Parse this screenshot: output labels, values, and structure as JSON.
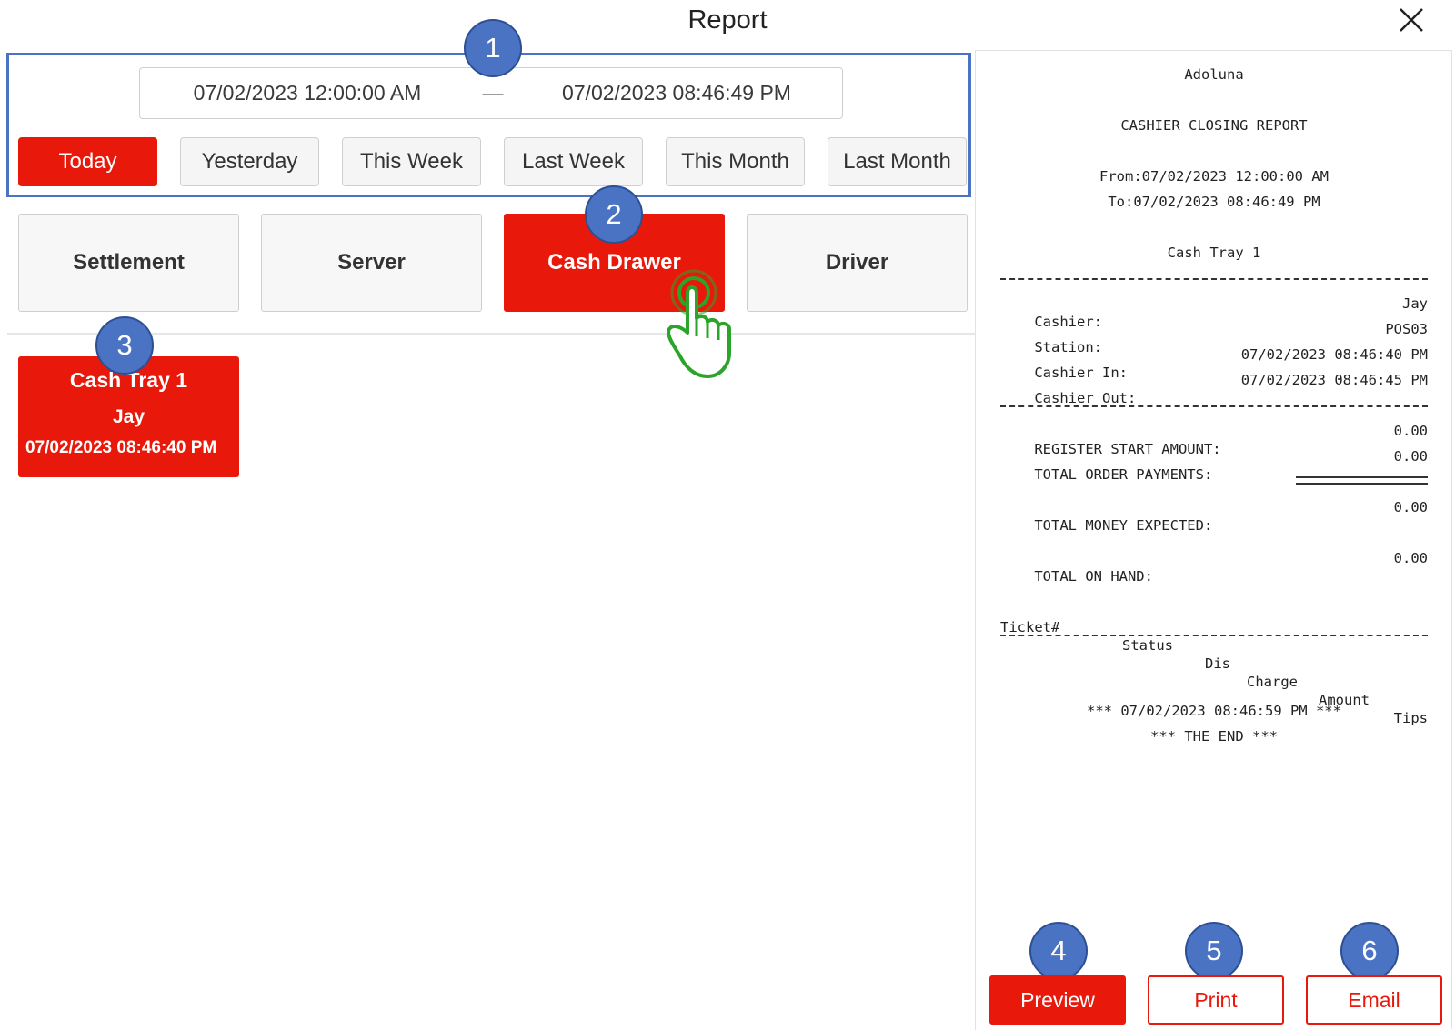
{
  "header": {
    "title": "Report"
  },
  "date_range": {
    "from": "07/02/2023 12:00:00 AM",
    "separator": "—",
    "to": "07/02/2023 08:46:49 PM"
  },
  "presets": [
    "Today",
    "Yesterday",
    "This Week",
    "Last Week",
    "This Month",
    "Last Month"
  ],
  "report_types": [
    "Settlement",
    "Server",
    "Cash Drawer",
    "Driver"
  ],
  "tray": {
    "name": "Cash Tray 1",
    "cashier": "Jay",
    "time": "07/02/2023 08:46:40 PM"
  },
  "badges": [
    "1",
    "2",
    "3",
    "4",
    "5",
    "6"
  ],
  "receipt": {
    "store": "Adoluna",
    "title": "CASHIER CLOSING REPORT",
    "from": "From:07/02/2023 12:00:00 AM",
    "to": "To:07/02/2023 08:46:49 PM",
    "tray": "Cash Tray 1",
    "cashier_label": "Cashier:",
    "cashier_value": "Jay",
    "station_label": "Station:",
    "station_value": "POS03",
    "in_label": "Cashier In:",
    "in_value": "07/02/2023 08:46:40 PM",
    "out_label": "Cashier Out:",
    "out_value": "07/02/2023 08:46:45 PM",
    "start_label": "REGISTER START AMOUNT:",
    "start_value": "0.00",
    "payments_label": "TOTAL ORDER PAYMENTS:",
    "payments_value": "0.00",
    "expected_label": "TOTAL MONEY EXPECTED:",
    "expected_value": "0.00",
    "onhand_label": "TOTAL ON HAND:",
    "onhand_value": "0.00",
    "columns": [
      "Ticket#",
      "Status",
      "Dis",
      "Charge",
      "Amount",
      "Tips"
    ],
    "timestamp": "*** 07/02/2023 08:46:59 PM ***",
    "end": "*** THE END ***"
  },
  "actions": {
    "preview": "Preview",
    "print": "Print",
    "email": "Email"
  },
  "colors": {
    "accent": "#e8190b",
    "badge": "#4a73c4",
    "highlight_box": "#4a74c2",
    "cursor": "#2aa52a"
  },
  "icons": {
    "close": "close-icon",
    "cursor": "tap-hand-icon"
  }
}
